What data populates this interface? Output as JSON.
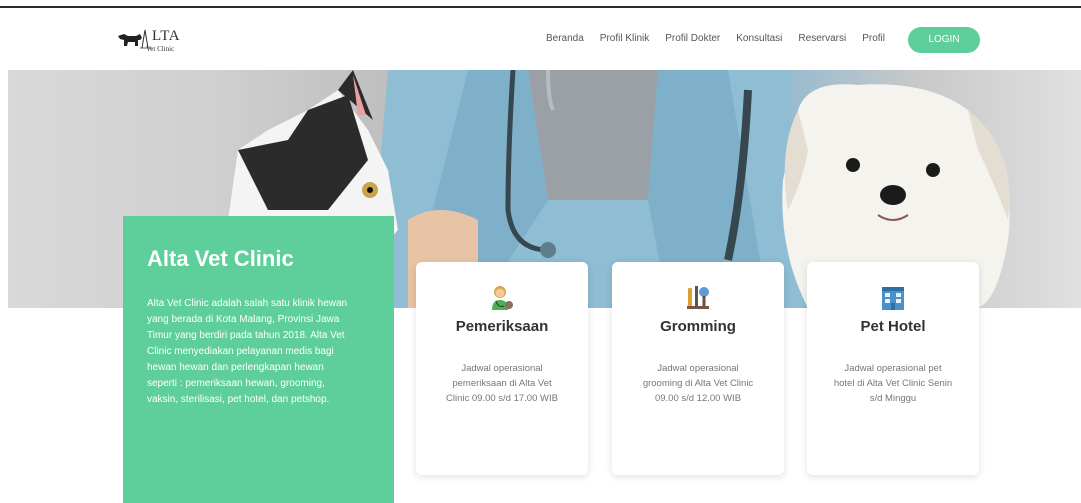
{
  "brand": {
    "logo_text": "LTA",
    "logo_sub": "Vet Clinic"
  },
  "nav": {
    "items": [
      "Beranda",
      "Profil Klinik",
      "Profil Dokter",
      "Konsultasi",
      "Reservarsi",
      "Profil"
    ],
    "login_label": "LOGIN"
  },
  "colors": {
    "accent": "#5ecf9b",
    "text": "#333333"
  },
  "about": {
    "title": "Alta Vet Clinic",
    "description": "Alta Vet Clinic adalah salah satu klinik hewan yang berada di Kota Malang, Provinsi Jawa Timur yang berdiri pada tahun 2018. Alta Vet Clinic menyediakan pelayanan medis bagi hewan hewan dan perlengkapan hewan seperti : pemeriksaan hewan, grooming, vaksin, sterilisasi, pet hotel, dan petshop."
  },
  "services": [
    {
      "icon": "doctor-icon",
      "title": "Pemeriksaan",
      "description": "Jadwal operasional pemeriksaan di Alta Vet Clinic 09.00 s/d 17.00 WIB"
    },
    {
      "icon": "grooming-tools-icon",
      "title": "Gromming",
      "description": "Jadwal operasional grooming di Alta Vet Clinic 09.00 s/d 12.00 WIB"
    },
    {
      "icon": "hotel-building-icon",
      "title": "Pet Hotel",
      "description": "Jadwal operasional pet hotel di Alta Vet Clinic Senin s/d Minggu"
    }
  ]
}
